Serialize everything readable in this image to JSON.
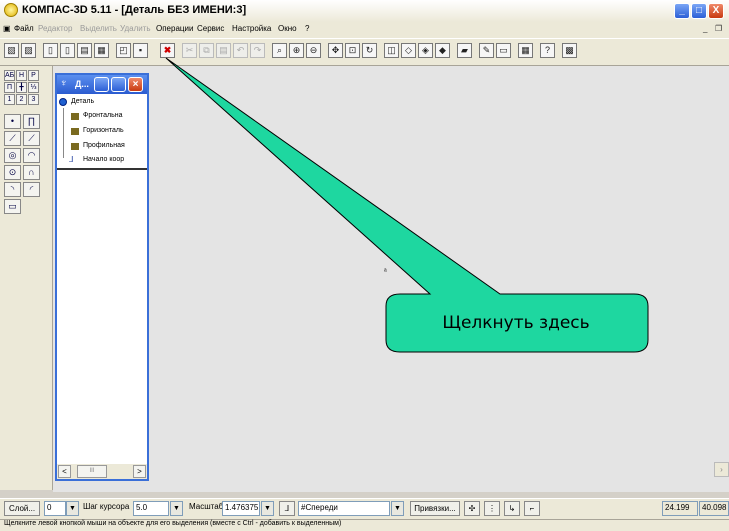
{
  "window": {
    "title": "КОМПАС-3D 5.11 - [Деталь БЕЗ ИМЕНИ:3]",
    "minimize": "_",
    "maximize": "□",
    "close": "X"
  },
  "menu": {
    "items": [
      {
        "label": "Файл",
        "enabled": true
      },
      {
        "label": "Редактор",
        "enabled": false
      },
      {
        "label": "Выделить",
        "enabled": false
      },
      {
        "label": "Удалить",
        "enabled": false
      },
      {
        "label": "Операции",
        "enabled": true
      },
      {
        "label": "Сервис",
        "enabled": true
      },
      {
        "label": "Настройка",
        "enabled": true
      },
      {
        "label": "Окно",
        "enabled": true
      },
      {
        "label": "?",
        "enabled": true
      }
    ],
    "mdi_minimize": "_",
    "mdi_restore": "❐"
  },
  "palette": {
    "top_labels": [
      "АБ",
      "Н",
      "Р",
      "П",
      "╋",
      "⅓",
      "1",
      "2",
      "3"
    ]
  },
  "tree": {
    "title": "Д...",
    "root": "Деталь",
    "items": [
      "Фронтальна",
      "Горизонталь",
      "Профильная",
      "Начало коор"
    ],
    "scroll_left": "<",
    "scroll_right": ">",
    "scroll_thumb": "III"
  },
  "callout": {
    "text": "Щелкнуть здесь",
    "fill": "#1ed7a0",
    "stroke": "#000000"
  },
  "bottom": {
    "layer_label": "Слой...",
    "layer_value": "0",
    "step_label": "Шаг курсора",
    "step_value": "5.0",
    "scale_label": "Масштаб",
    "scale_value": "1.476375",
    "view_value": "#Спереди",
    "snap_label": "Привязки...",
    "coord_x": "24.199",
    "coord_y": "40.098"
  },
  "status": {
    "text": "Щелкните левой кнопкой мыши на объекте для его выделения (вместе с Ctrl - добавить к выделенным)"
  }
}
